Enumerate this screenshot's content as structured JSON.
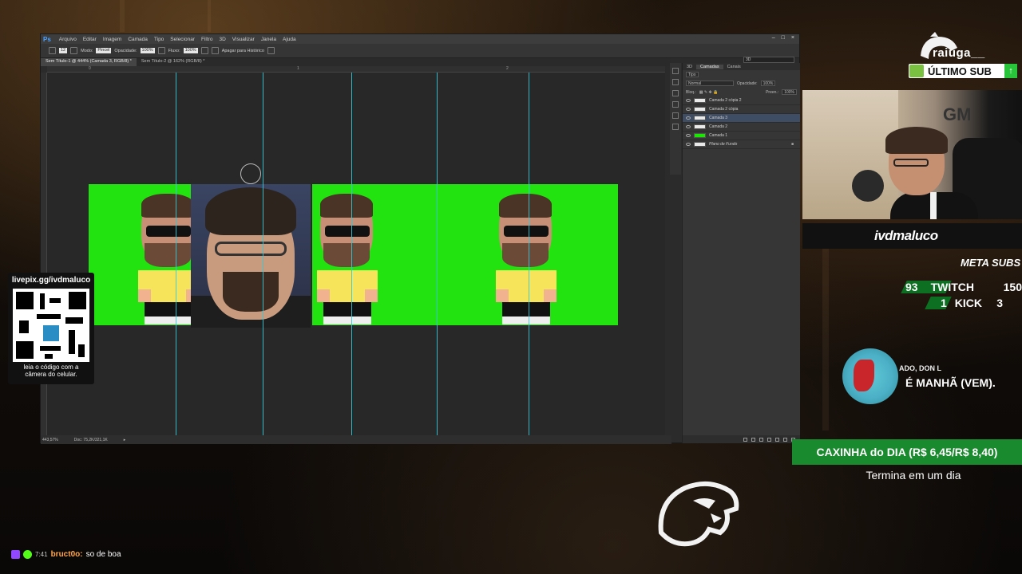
{
  "ps": {
    "logo": "Ps",
    "menu": [
      "Arquivo",
      "Editar",
      "Imagem",
      "Camada",
      "Tipo",
      "Selecionar",
      "Filtro",
      "3D",
      "Visualizar",
      "Janela",
      "Ajuda"
    ],
    "options": {
      "size": "12",
      "modo_label": "Modo:",
      "modo_value": "Pincel",
      "opacidade_label": "Opacidade:",
      "opacidade_value": "100%",
      "fluxo_label": "Fluxo:",
      "fluxo_value": "100%",
      "historico_label": "Apagar para Histórico",
      "workspace": "3D"
    },
    "tabs": [
      "Sem Título-1 @ 444% (Camada 3, RGB/8) *",
      "Sem Título-2 @ 162% (RGB/8) *"
    ],
    "ruler_marks": [
      "0",
      "1",
      "2"
    ],
    "status": {
      "zoom": "443,57%",
      "doc": "Doc: 75,2K/321,1K"
    },
    "panel": {
      "tabs": [
        "3D",
        "Camadas",
        "Canais"
      ],
      "filter": "Tipo",
      "blend": "Normal",
      "opacity_label": "Opacidade:",
      "opacity_value": "100%",
      "lock_label": "Bloq.:",
      "fill_label": "Preen.:",
      "fill_value": "100%",
      "layers": [
        "Camada 2 cópia 2",
        "Camada 2 cópia",
        "Camada 3",
        "Camada 2",
        "Camada 1",
        "Plano de Fundo"
      ]
    }
  },
  "qr": {
    "url": "livepix.gg/ivdmaluco",
    "caption_line1": "leia o código com a",
    "caption_line2": "câmera do celular."
  },
  "overlay": {
    "sub_name": "raiuga__",
    "last_sub": "ÚLTIMO SUB",
    "channel": "ivdmaluco",
    "meta_title": "META SUBS",
    "twitch": {
      "label": "TWITCH",
      "current": "93",
      "goal": "150"
    },
    "kick": {
      "label": "KICK",
      "current": "1",
      "goal": "3"
    },
    "music_artist": "ADO, DON L",
    "music_title": "É MANHÃ (VEM).",
    "caxinha": "CAXINHA do DIA (R$ 6,45/R$ 8,40)",
    "caxinha_sub": "Termina em um dia"
  },
  "chat": {
    "time": "7:41",
    "user": "bruct0o:",
    "message": "so de boa"
  },
  "colors": {
    "green_screen": "#22e20f",
    "guide": "#39c6d8",
    "accent_green": "#1a8a2e"
  }
}
